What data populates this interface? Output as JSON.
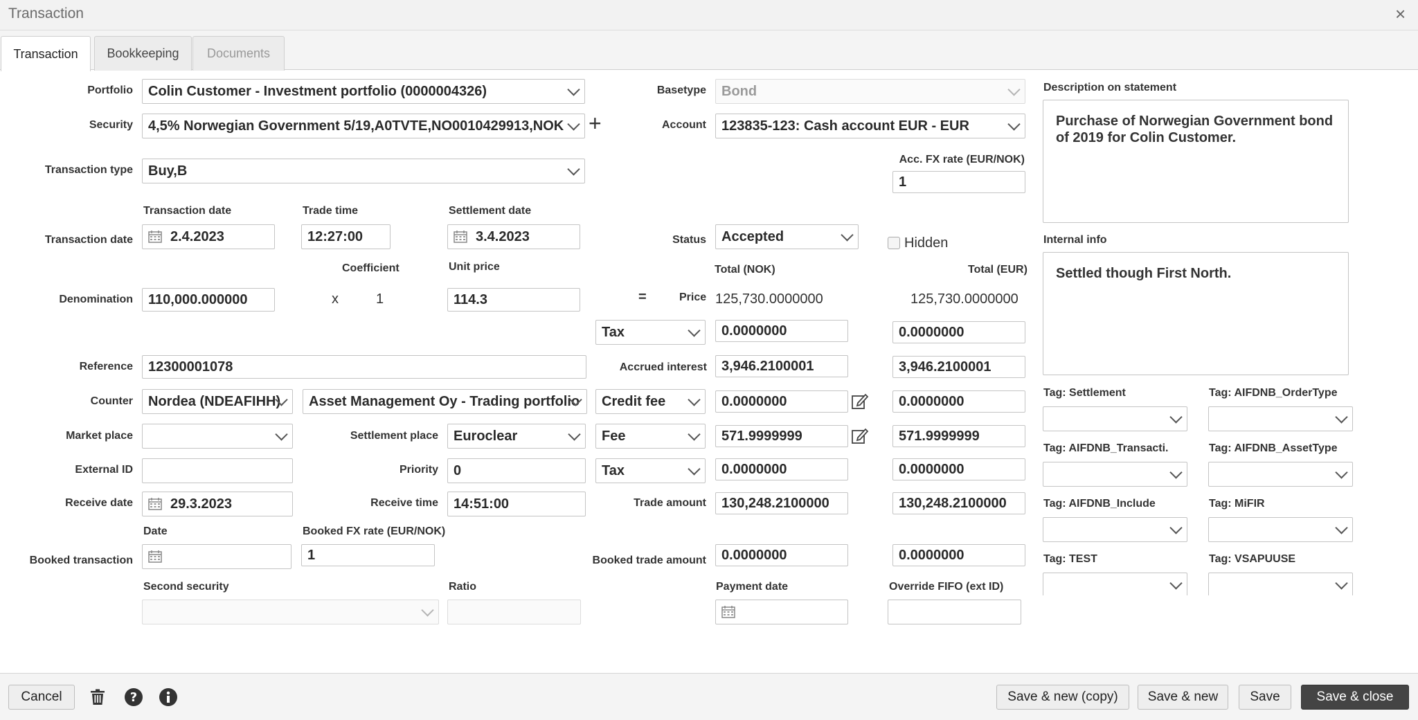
{
  "window": {
    "title": "Transaction",
    "close_glyph": "×"
  },
  "tabs": [
    {
      "label": "Transaction",
      "state": "active"
    },
    {
      "label": "Bookkeeping",
      "state": "normal"
    },
    {
      "label": "Documents",
      "state": "disabled"
    }
  ],
  "portfolio": {
    "label": "Portfolio",
    "value": "Colin Customer - Investment portfolio (0000004326)"
  },
  "security": {
    "label": "Security",
    "value": "4,5% Norwegian Government 5/19,A0TVTE,NO0010429913,NOK",
    "add_glyph": "+"
  },
  "transaction_type": {
    "label": "Transaction type",
    "value": "Buy,B"
  },
  "basetype": {
    "label": "Basetype",
    "value": "Bond"
  },
  "account": {
    "label": "Account",
    "value": "123835-123: Cash account EUR - EUR"
  },
  "acc_fx": {
    "label": "Acc. FX rate (EUR/NOK)",
    "value": "1"
  },
  "dates": {
    "row_label": "Transaction date",
    "transaction_date_label": "Transaction date",
    "transaction_date": "2.4.2023",
    "trade_time_label": "Trade time",
    "trade_time": "12:27:00",
    "settlement_date_label": "Settlement date",
    "settlement_date": "3.4.2023"
  },
  "status": {
    "label": "Status",
    "value": "Accepted"
  },
  "hidden": {
    "label": "Hidden"
  },
  "totals": {
    "nok_header": "Total (NOK)",
    "eur_header": "Total (EUR)"
  },
  "denomination": {
    "label": "Denomination",
    "value": "110,000.000000",
    "x_sign": "x",
    "coefficient_label": "Coefficient",
    "coefficient": "1",
    "unit_price_label": "Unit price",
    "unit_price": "114.3",
    "eq_sign": "=",
    "price_label": "Price",
    "price_nok": "125,730.0000000",
    "price_eur": "125,730.0000000"
  },
  "tax_row1": {
    "type": "Tax",
    "nok": "0.0000000",
    "eur": "0.0000000"
  },
  "reference": {
    "label": "Reference",
    "value": "12300001078"
  },
  "accrued": {
    "label": "Accrued interest",
    "nok": "3,946.2100001",
    "eur": "3,946.2100001"
  },
  "counter": {
    "label": "Counter",
    "value": "Nordea (NDEAFIHH)",
    "party": "Asset Management Oy - Trading portfolio"
  },
  "credit_fee": {
    "type": "Credit fee",
    "nok": "0.0000000",
    "eur": "0.0000000"
  },
  "market_place": {
    "label": "Market place",
    "value": ""
  },
  "settlement_place": {
    "label": "Settlement place",
    "value": "Euroclear"
  },
  "fee": {
    "type": "Fee",
    "nok": "571.9999999",
    "eur": "571.9999999"
  },
  "external_id": {
    "label": "External ID",
    "value": ""
  },
  "priority": {
    "label": "Priority",
    "value": "0"
  },
  "tax_row2": {
    "type": "Tax",
    "nok": "0.0000000",
    "eur": "0.0000000"
  },
  "receive": {
    "date_label": "Receive date",
    "date": "29.3.2023",
    "time_label": "Receive time",
    "time": "14:51:00"
  },
  "trade_amount": {
    "label": "Trade amount",
    "nok": "130,248.2100000",
    "eur": "130,248.2100000"
  },
  "booked": {
    "row_label": "Booked transaction",
    "date_label": "Date",
    "date": "",
    "fx_label": "Booked FX rate (EUR/NOK)",
    "fx": "1",
    "amount_label": "Booked trade amount",
    "amount_nok": "0.0000000",
    "amount_eur": "0.0000000"
  },
  "second_security": {
    "label": "Second security",
    "value": "",
    "ratio_label": "Ratio",
    "ratio": ""
  },
  "payment_date": {
    "label": "Payment date",
    "value": ""
  },
  "override_fifo": {
    "label": "Override FIFO (ext ID)",
    "value": ""
  },
  "description": {
    "label": "Description on statement",
    "value": "Purchase of Norwegian Government bond of 2019 for Colin Customer."
  },
  "internal_info": {
    "label": "Internal info",
    "value": "Settled though First North."
  },
  "tags": [
    {
      "label": "Tag: Settlement",
      "value": ""
    },
    {
      "label": "Tag: AIFDNB_OrderType",
      "value": ""
    },
    {
      "label": "Tag: AIFDNB_Transacti.",
      "value": ""
    },
    {
      "label": "Tag: AIFDNB_AssetType",
      "value": ""
    },
    {
      "label": "Tag: AIFDNB_Include",
      "value": ""
    },
    {
      "label": "Tag: MiFIR",
      "value": ""
    },
    {
      "label": "Tag: TEST",
      "value": ""
    },
    {
      "label": "Tag: VSAPUUSE",
      "value": ""
    }
  ],
  "footer": {
    "cancel": "Cancel",
    "save_new_copy": "Save & new (copy)",
    "save_new": "Save & new",
    "save": "Save",
    "save_close": "Save & close"
  },
  "icons": [
    "close-icon",
    "add-icon",
    "chevron-down-icon",
    "calendar-icon",
    "edit-icon",
    "trash-icon",
    "help-icon",
    "info-icon"
  ]
}
